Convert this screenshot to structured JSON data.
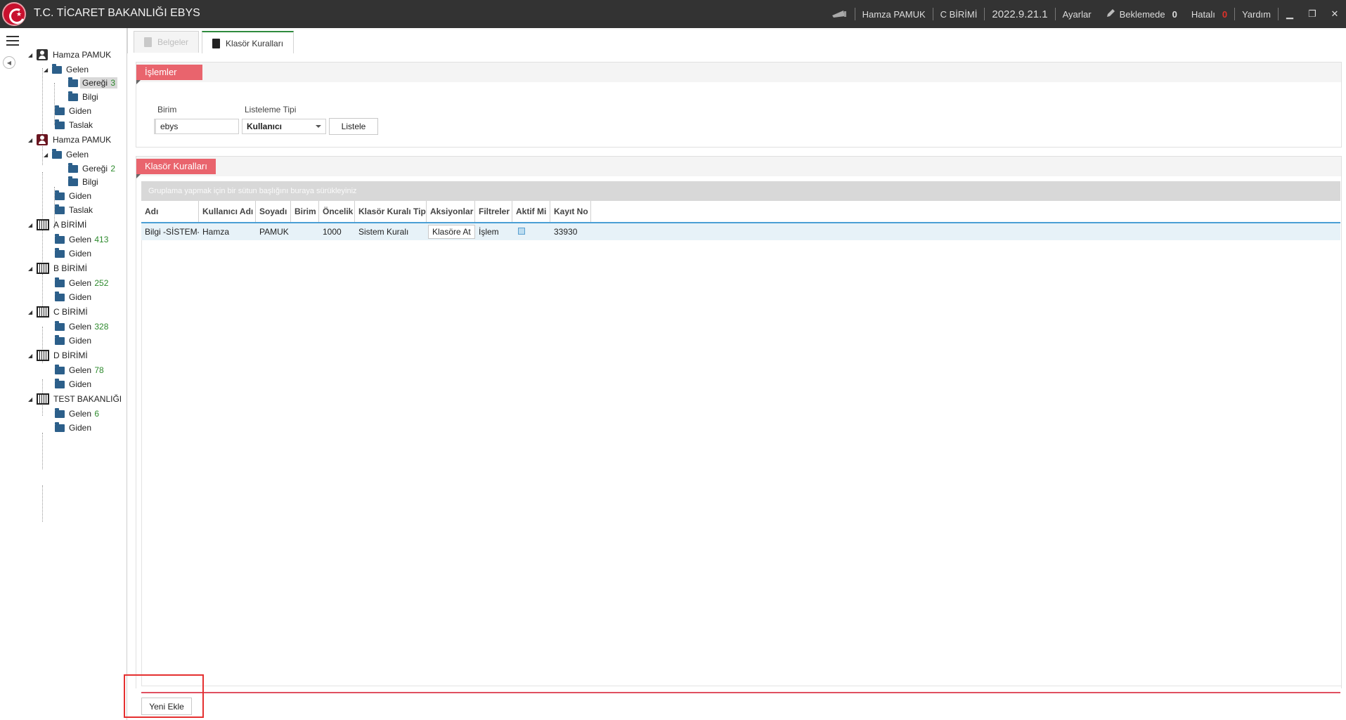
{
  "app": {
    "title": "T.C. TİCARET BAKANLIĞI EBYS"
  },
  "topbar": {
    "user": "Hamza PAMUK",
    "unit": "C BİRİMİ",
    "version": "2022.9.21.1",
    "settings": "Ayarlar",
    "pending_label": "Beklemede",
    "pending_count": "0",
    "error_label": "Hatalı",
    "error_count": "0",
    "help": "Yardım"
  },
  "tree": {
    "nodes": [
      {
        "label": "Hamza PAMUK"
      },
      {
        "label": "Gelen"
      },
      {
        "label": "Gereği",
        "count": "3"
      },
      {
        "label": "Bilgi"
      },
      {
        "label": "Giden"
      },
      {
        "label": "Taslak"
      },
      {
        "label": "Hamza PAMUK"
      },
      {
        "label": "Gelen"
      },
      {
        "label": "Gereği",
        "count": "2"
      },
      {
        "label": "Bilgi"
      },
      {
        "label": "Giden"
      },
      {
        "label": "Taslak"
      },
      {
        "label": "A BİRİMİ"
      },
      {
        "label": "Gelen",
        "count": "413"
      },
      {
        "label": "Giden"
      },
      {
        "label": "B BİRİMİ"
      },
      {
        "label": "Gelen",
        "count": "252"
      },
      {
        "label": "Giden"
      },
      {
        "label": "C BİRİMİ"
      },
      {
        "label": "Gelen",
        "count": "328"
      },
      {
        "label": "Giden"
      },
      {
        "label": "D BİRİMİ"
      },
      {
        "label": "Gelen",
        "count": "78"
      },
      {
        "label": "Giden"
      },
      {
        "label": "TEST BAKANLIĞI"
      },
      {
        "label": "Gelen",
        "count": "6"
      },
      {
        "label": "Giden"
      }
    ]
  },
  "tabs": [
    {
      "label": "Belgeler"
    },
    {
      "label": "Klasör Kuralları"
    }
  ],
  "operations": {
    "title": "İşlemler",
    "unit_label": "Birim",
    "unit_value": "ebys",
    "list_type_label": "Listeleme Tipi",
    "list_type_value": "Kullanıcı",
    "list_button": "Listele"
  },
  "rules": {
    "title": "Klasör Kuralları",
    "group_hint": "Gruplama yapmak için bir sütun başlığını buraya sürükleyiniz",
    "columns": [
      "Adı",
      "Kullanıcı Adı",
      "Soyadı",
      "Birim",
      "Öncelik",
      "Klasör Kuralı Tipi",
      "Aksiyonlar",
      "Filtreler",
      "Aktif Mi",
      "Kayıt No"
    ],
    "rows": [
      {
        "name": "Bilgi -SİSTEM-",
        "username": "Hamza",
        "surname": "PAMUK",
        "unit": "",
        "priority": "1000",
        "rule_type": "Sistem Kuralı",
        "action": "Klasöre At",
        "filters": "İşlem",
        "active": true,
        "record_no": "33930"
      }
    ],
    "add_button": "Yeni Ekle"
  }
}
